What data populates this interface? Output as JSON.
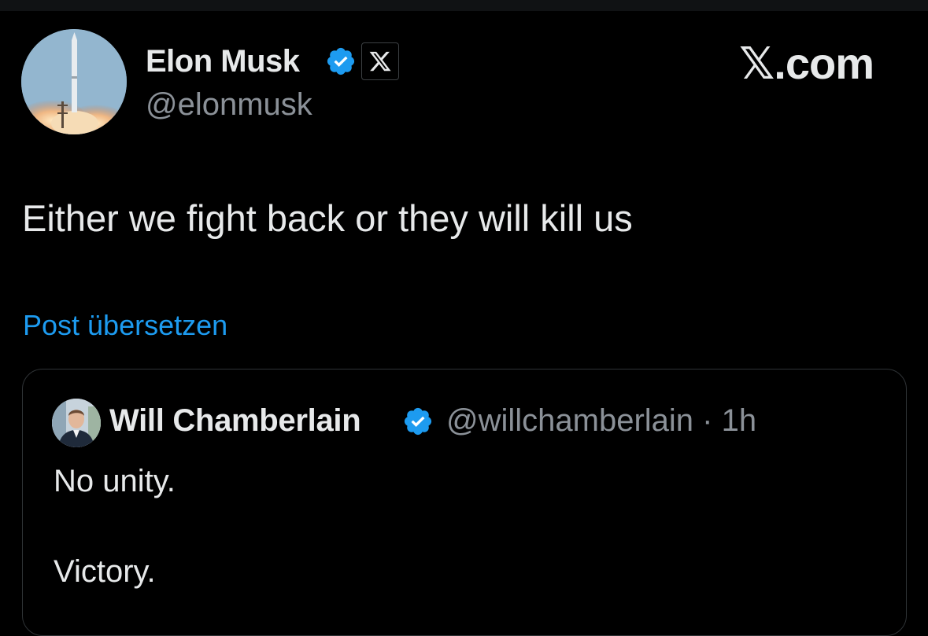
{
  "author": {
    "name": "Elon Musk",
    "handle": "@elonmusk",
    "verified": true,
    "affiliation_badge_icon": "x-logo-icon"
  },
  "site_wordmark": "𝕏.com",
  "post": {
    "text": "Either we fight back or they will kill us",
    "translate_link": "Post übersetzen"
  },
  "quoted_post": {
    "author_name": "Will Chamberlain",
    "verified": true,
    "meta": "@willchamberlain · 1h",
    "lines": [
      "No unity.",
      "Victory."
    ]
  },
  "colors": {
    "background": "#000000",
    "text_primary": "#e7e9ea",
    "text_secondary": "#8b9198",
    "link": "#1d9bf0",
    "verified_badge": "#1d9bf0",
    "card_border": "#2f3336"
  }
}
